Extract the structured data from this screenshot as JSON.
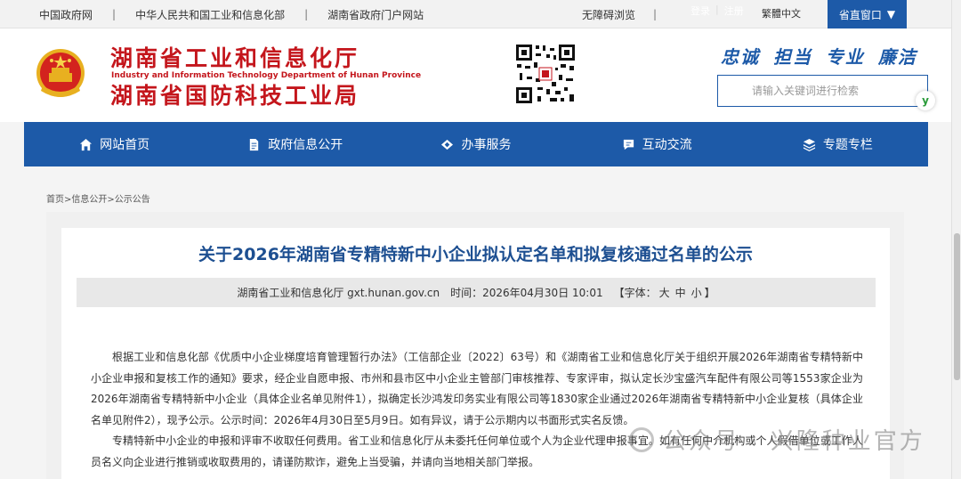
{
  "topbar": {
    "links": [
      "中国政府网",
      "中华人民共和国工业和信息化部",
      "湖南省政府门户网站"
    ],
    "accessibility": "无障碍浏览",
    "login": "登录",
    "register": "注册",
    "traditional": "繁體中文",
    "window_button": "省直窗口",
    "window_icon": "triangle-down"
  },
  "header": {
    "title_line1": "湖南省工业和信息化厅",
    "title_en": "Industry and Information Technology Department of Hunan Province",
    "title_line2": "湖南省国防科技工业局",
    "slogan": "忠诚 担当 专业 廉洁",
    "search_placeholder": "请输入关键词进行检索",
    "search_badge": "y"
  },
  "nav": {
    "items": [
      {
        "label": "网站首页",
        "icon": "home-icon"
      },
      {
        "label": "政府信息公开",
        "icon": "document-icon"
      },
      {
        "label": "办事服务",
        "icon": "service-icon"
      },
      {
        "label": "互动交流",
        "icon": "chat-icon"
      },
      {
        "label": "专题专栏",
        "icon": "layers-icon"
      }
    ]
  },
  "breadcrumb": "首页>信息公开>公示公告",
  "article": {
    "title": "关于2026年湖南省专精特新中小企业拟认定名单和拟复核通过名单的公示",
    "source": "湖南省工业和信息化厅 gxt.hunan.gov.cn",
    "time": "时间：2026年04月30日 10:01",
    "font_label": "【字体：",
    "font_large": "大",
    "font_medium": "中",
    "font_small": "小",
    "font_end": "】",
    "paragraphs": [
      "根据工业和信息化部《优质中小企业梯度培育管理暂行办法》（工信部企业〔2022〕63号）和《湖南省工业和信息化厅关于组织开展2026年湖南省专精特新中小企业申报和复核工作的通知》要求，经企业自愿申报、市州和县市区中小企业主管部门审核推荐、专家评审，拟认定长沙宝盛汽车配件有限公司等1553家企业为2026年湖南省专精特新中小企业（具体企业名单见附件1），拟确定长沙鸿发印务实业有限公司等1830家企业通过2026年湖南省专精特新中小企业复核（具体企业名单见附件2），现予公示。公示时间：2026年4月30日至5月9日。如有异议，请于公示期内以书面形式实名反馈。",
      "专精特新中小企业的申报和评审不收取任何费用。省工业和信息化厅从未委托任何单位或个人为企业代理申报事宜。如有任何中介机构或个人假借单位或工作人员名义向企业进行推销或收取费用的，请谨防欺诈，避免上当受骗，并请向当地相关部门举报。"
    ]
  },
  "watermark": "公众号 · 兴隆种业官方",
  "colors": {
    "brand_blue": "#1d5aa8",
    "brand_red": "#c4161c",
    "title_blue": "#1d4f91"
  }
}
